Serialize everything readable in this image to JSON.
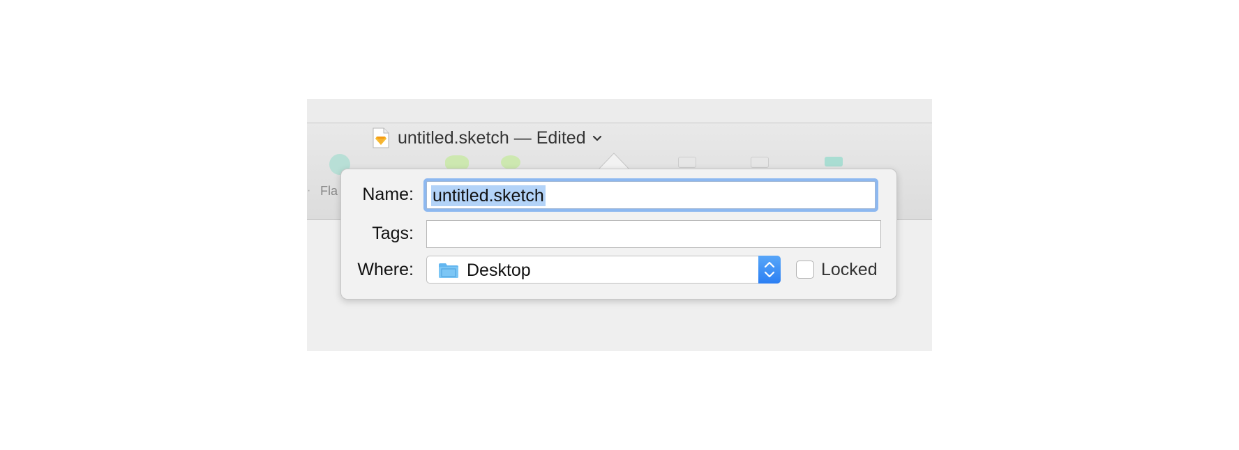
{
  "window": {
    "title": "untitled.sketch — Edited",
    "toolbar_partial_label": "Fla"
  },
  "popover": {
    "name_label": "Name:",
    "name_value": "untitled.sketch",
    "tags_label": "Tags:",
    "tags_value": "",
    "where_label": "Where:",
    "where_value": "Desktop",
    "locked_label": "Locked",
    "locked_checked": false
  },
  "colors": {
    "selection": "#b3d3f8",
    "focus_ring": "#8db8f0",
    "stepper_blue": "#2b7ff3",
    "folder_blue": "#62b6f0"
  },
  "icons": [
    "sketch-document-icon",
    "chevron-down-icon",
    "folder-icon",
    "stepper-arrows-icon"
  ]
}
